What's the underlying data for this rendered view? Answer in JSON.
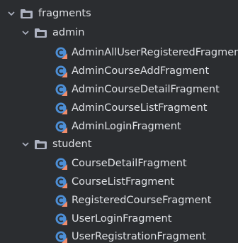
{
  "tree": {
    "root": {
      "label": "fragments",
      "icon": "folder-icon",
      "expanded": true,
      "children": [
        {
          "label": "admin",
          "icon": "folder-icon",
          "expanded": true,
          "items": [
            "AdminAllUserRegisteredFragment",
            "AdminCourseAddFragment",
            "AdminCourseDetailFragment",
            "AdminCourseListFragment",
            "AdminLoginFragment"
          ]
        },
        {
          "label": "student",
          "icon": "folder-icon",
          "expanded": true,
          "items": [
            "CourseDetailFragment",
            "CourseListFragment",
            "RegisteredCourseFragment",
            "UserLoginFragment",
            "UserRegistrationFragment"
          ]
        }
      ]
    },
    "colors": {
      "background": "#2b2d30",
      "text": "#dfe1e5",
      "chevron": "#aeb3c2",
      "folder": "#aeb3c2",
      "class_icon": "#4d8fd6",
      "class_badge": "#f08c6b"
    }
  }
}
